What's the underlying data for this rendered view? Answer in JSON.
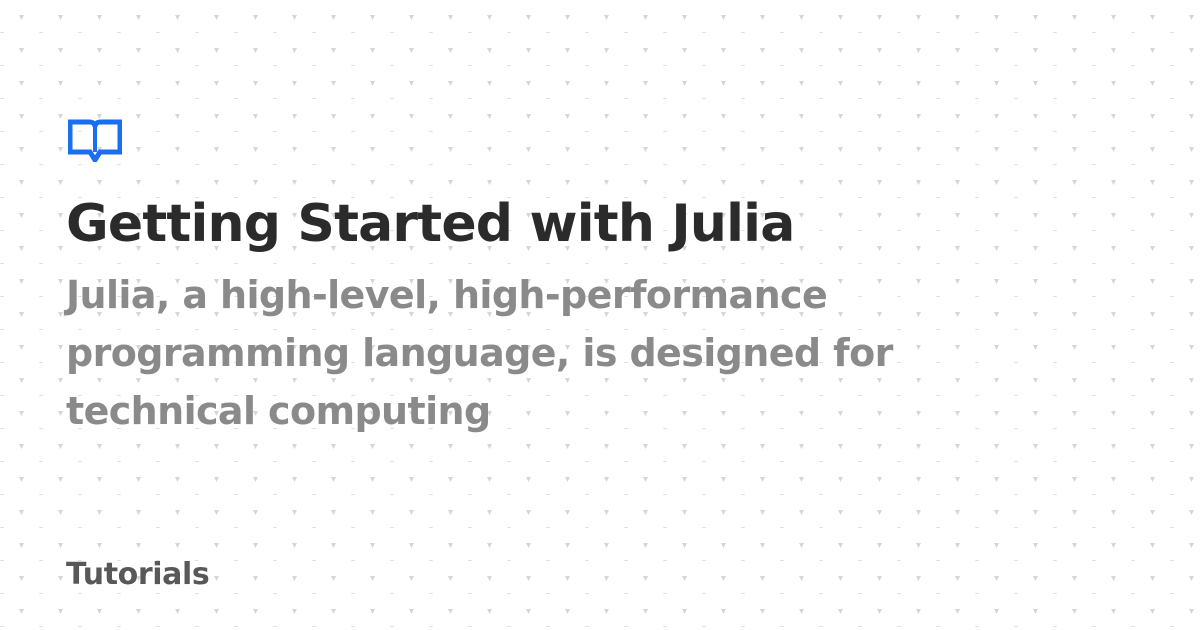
{
  "colors": {
    "background": "#ffffff",
    "pattern_dot": "#d6d6d6",
    "logo_accent": "#1a6ef0",
    "title": "#2b2b2b",
    "subtitle": "#8a8a8a",
    "category": "#585858"
  },
  "icons": {
    "logo": "book-icon"
  },
  "card": {
    "title": "Getting Started with Julia",
    "description": "Julia, a high-level, high-performance programming language, is designed for technical computing",
    "category": "Tutorials"
  }
}
